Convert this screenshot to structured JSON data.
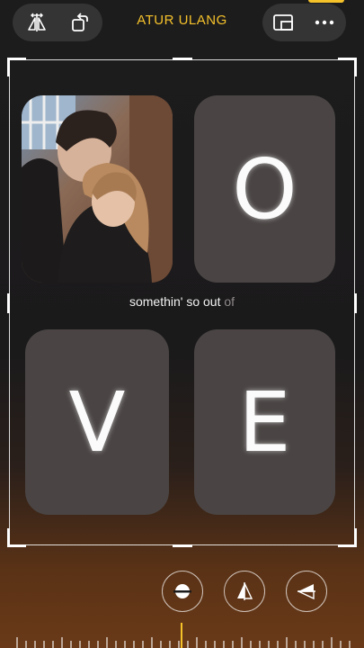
{
  "header": {
    "reset_label": "ATUR ULANG",
    "left_icons": [
      "flip-icon",
      "rotate-icon"
    ],
    "right_icons": [
      "aspect-ratio-icon",
      "more-icon"
    ],
    "accent_color": "#f5c22a"
  },
  "canvas": {
    "tiles": [
      {
        "letter": "O"
      },
      {
        "letter": "V"
      },
      {
        "letter": "E"
      }
    ],
    "caption_main": "somethin' so out ",
    "caption_faded": "of"
  },
  "toolbar": {
    "icons": [
      "straighten-icon",
      "vertical-perspective-icon",
      "horizontal-perspective-icon"
    ]
  }
}
